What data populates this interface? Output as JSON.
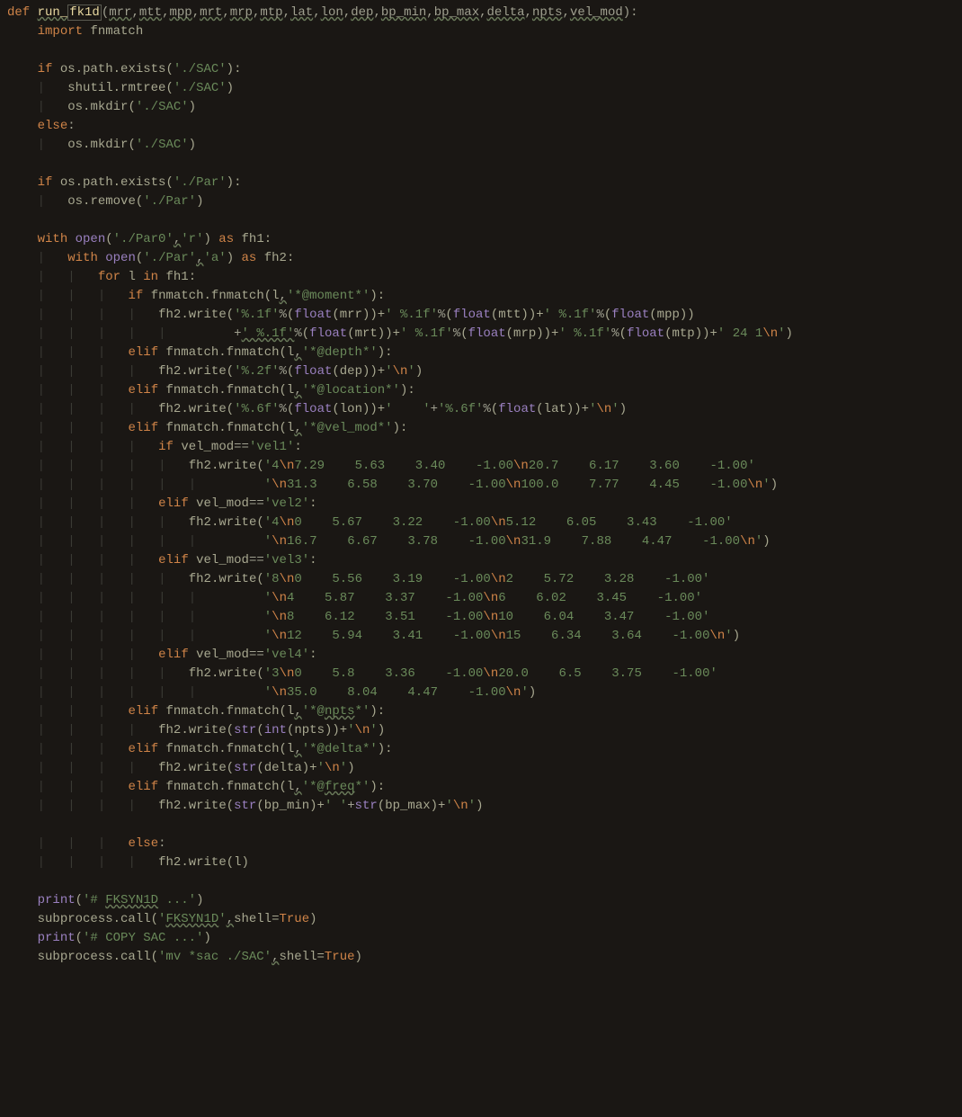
{
  "code": {
    "lines": [
      {
        "indent": 0,
        "html": "<span class='kw'>def </span><span class='fn underline-warn'>run_</span><span class='fn boxed'>fk1d</span><span class='paren'>(</span><span class='param underline-warn'>mrr</span><span class='op'>,</span><span class='param underline-warn'>mtt</span><span class='op'>,</span><span class='param underline-warn'>mpp</span><span class='op'>,</span><span class='param underline-warn'>mrt</span><span class='op'>,</span><span class='param underline-warn'>mrp</span><span class='op'>,</span><span class='param underline-warn'>mtp</span><span class='op'>,</span><span class='param underline-warn'>lat</span><span class='op'>,</span><span class='param underline-warn'>lon</span><span class='op'>,</span><span class='param underline-warn'>dep</span><span class='op'>,</span><span class='param underline-warn'>bp_min</span><span class='op'>,</span><span class='param underline-warn'>bp_max</span><span class='op'>,</span><span class='param underline-warn'>delta</span><span class='op'>,</span><span class='param underline-warn'>npts</span><span class='op'>,</span><span class='param underline-warn'>vel_mod</span><span class='paren'>)</span><span class='op'>:</span>"
      },
      {
        "indent": 1,
        "html": "<span class='kw'>import </span><span class='id'>fnmatch</span>"
      },
      {
        "indent": 0,
        "html": ""
      },
      {
        "indent": 1,
        "html": "<span class='kw'>if </span><span class='id'>os.path.exists(</span><span class='str'>'./SAC'</span><span class='id'>):</span>"
      },
      {
        "indent": 2,
        "html": "<span class='id'>shutil.rmtree(</span><span class='str'>'./SAC'</span><span class='id'>)</span>"
      },
      {
        "indent": 2,
        "html": "<span class='id'>os.mkdir(</span><span class='str'>'./SAC'</span><span class='id'>)</span>"
      },
      {
        "indent": 1,
        "html": "<span class='kw'>else</span><span class='op'>:</span>"
      },
      {
        "indent": 2,
        "html": "<span class='id'>os.mkdir(</span><span class='str'>'./SAC'</span><span class='id'>)</span>"
      },
      {
        "indent": 0,
        "html": ""
      },
      {
        "indent": 1,
        "html": "<span class='kw'>if </span><span class='id'>os.path.exists(</span><span class='str'>'./Par'</span><span class='id'>):</span>"
      },
      {
        "indent": 2,
        "html": "<span class='id'>os.remove(</span><span class='str'>'./Par'</span><span class='id'>)</span>"
      },
      {
        "indent": 0,
        "html": ""
      },
      {
        "indent": 1,
        "html": "<span class='kw'>with </span><span class='builtin'>open</span><span class='id'>(</span><span class='str'>'./Par0'</span><span class='op underline-warn'>,</span><span class='str'>'r'</span><span class='id'>) </span><span class='kw'>as </span><span class='id'>fh1:</span>"
      },
      {
        "indent": 2,
        "html": "<span class='kw'>with </span><span class='builtin'>open</span><span class='id'>(</span><span class='str'>'./Par'</span><span class='op underline-warn'>,</span><span class='str'>'a'</span><span class='id'>) </span><span class='kw'>as </span><span class='id'>fh2:</span>"
      },
      {
        "indent": 3,
        "html": "<span class='kw'>for </span><span class='id'>l </span><span class='kw'>in </span><span class='id'>fh1:</span>"
      },
      {
        "indent": 4,
        "html": "<span class='kw'>if </span><span class='id'>fnmatch.fnmatch(l</span><span class='op underline-warn'>,</span><span class='str'>'*@moment*'</span><span class='id'>):</span>"
      },
      {
        "indent": 5,
        "html": "<span class='id'>fh2.write(</span><span class='str'>'%.1f'</span><span class='op'>%</span><span class='id'>(</span><span class='builtin'>float</span><span class='id'>(mrr))+</span><span class='str'>' %.1f'</span><span class='op'>%</span><span class='id'>(</span><span class='builtin'>float</span><span class='id'>(mtt))+</span><span class='str'>' %.1f'</span><span class='op'>%</span><span class='id'>(</span><span class='builtin'>float</span><span class='id'>(mpp))</span>"
      },
      {
        "indent": 5,
        "html": "<span class='guide'>|</span>         <span class='op'>+</span><span class='str underline-warn'>' %.1f'</span><span class='op'>%</span><span class='id'>(</span><span class='builtin'>float</span><span class='id'>(mrt))+</span><span class='str'>' %.1f'</span><span class='op'>%</span><span class='id'>(</span><span class='builtin'>float</span><span class='id'>(mrp))+</span><span class='str'>' %.1f'</span><span class='op'>%</span><span class='id'>(</span><span class='builtin'>float</span><span class='id'>(mtp))+</span><span class='str'>' 24 1</span><span class='kw'>\\n</span><span class='str'>'</span><span class='id'>)</span>"
      },
      {
        "indent": 4,
        "html": "<span class='kw'>elif </span><span class='id'>fnmatch.fnmatch(l</span><span class='op underline-warn'>,</span><span class='str'>'*@depth*'</span><span class='id'>):</span>"
      },
      {
        "indent": 5,
        "html": "<span class='id'>fh2.write(</span><span class='str'>'%.2f'</span><span class='op'>%</span><span class='id'>(</span><span class='builtin'>float</span><span class='id'>(dep))+</span><span class='str'>'</span><span class='kw'>\\n</span><span class='str'>'</span><span class='id'>)</span>"
      },
      {
        "indent": 4,
        "html": "<span class='kw'>elif </span><span class='id'>fnmatch.fnmatch(l</span><span class='op underline-warn'>,</span><span class='str'>'*@location*'</span><span class='id'>):</span>"
      },
      {
        "indent": 5,
        "html": "<span class='id'>fh2.write(</span><span class='str'>'%.6f'</span><span class='op'>%</span><span class='id'>(</span><span class='builtin'>float</span><span class='id'>(lon))+</span><span class='str'>'    '</span><span class='op'>+</span><span class='str'>'%.6f'</span><span class='op'>%</span><span class='id'>(</span><span class='builtin'>float</span><span class='id'>(lat))+</span><span class='str'>'</span><span class='kw'>\\n</span><span class='str'>'</span><span class='id'>)</span>"
      },
      {
        "indent": 4,
        "html": "<span class='kw'>elif </span><span class='id'>fnmatch.fnmatch(l</span><span class='op underline-warn'>,</span><span class='str'>'*@vel_mod*'</span><span class='id'>):</span>"
      },
      {
        "indent": 5,
        "html": "<span class='kw'>if </span><span class='id'>vel_mod</span><span class='op'>==</span><span class='str'>'vel1'</span><span class='id'>:</span>"
      },
      {
        "indent": 6,
        "html": "<span class='id'>fh2.write(</span><span class='str'>'4</span><span class='kw'>\\n</span><span class='str'>7.29    5.63    3.40    -1.00</span><span class='kw'>\\n</span><span class='str'>20.7    6.17    3.60    -1.00'</span>"
      },
      {
        "indent": 6,
        "html": "<span class='guide'>|</span>         <span class='str'>'</span><span class='kw'>\\n</span><span class='str'>31.3    6.58    3.70    -1.00</span><span class='kw'>\\n</span><span class='str'>100.0    7.77    4.45    -1.00</span><span class='kw'>\\n</span><span class='str'>'</span><span class='id'>)</span>"
      },
      {
        "indent": 5,
        "html": "<span class='kw'>elif </span><span class='id'>vel_mod</span><span class='op'>==</span><span class='str'>'vel2'</span><span class='id'>:</span>"
      },
      {
        "indent": 6,
        "html": "<span class='id'>fh2.write(</span><span class='str'>'4</span><span class='kw'>\\n</span><span class='str'>0    5.67    3.22    -1.00</span><span class='kw'>\\n</span><span class='str'>5.12    6.05    3.43    -1.00'</span>"
      },
      {
        "indent": 6,
        "html": "<span class='guide'>|</span>         <span class='str'>'</span><span class='kw'>\\n</span><span class='str'>16.7    6.67    3.78    -1.00</span><span class='kw'>\\n</span><span class='str'>31.9    7.88    4.47    -1.00</span><span class='kw'>\\n</span><span class='str'>'</span><span class='id'>)</span>"
      },
      {
        "indent": 5,
        "html": "<span class='kw'>elif </span><span class='id'>vel_mod</span><span class='op'>==</span><span class='str'>'vel3'</span><span class='id'>:</span>"
      },
      {
        "indent": 6,
        "html": "<span class='id'>fh2.write(</span><span class='str'>'8</span><span class='kw'>\\n</span><span class='str'>0    5.56    3.19    -1.00</span><span class='kw'>\\n</span><span class='str'>2    5.72    3.28    -1.00'</span>"
      },
      {
        "indent": 6,
        "html": "<span class='guide'>|</span>         <span class='str'>'</span><span class='kw'>\\n</span><span class='str'>4    5.87    3.37    -1.00</span><span class='kw'>\\n</span><span class='str'>6    6.02    3.45    -1.00'</span>"
      },
      {
        "indent": 6,
        "html": "<span class='guide'>|</span>         <span class='str'>'</span><span class='kw'>\\n</span><span class='str'>8    6.12    3.51    -1.00</span><span class='kw'>\\n</span><span class='str'>10    6.04    3.47    -1.00'</span>"
      },
      {
        "indent": 6,
        "html": "<span class='guide'>|</span>         <span class='str'>'</span><span class='kw'>\\n</span><span class='str'>12    5.94    3.41    -1.00</span><span class='kw'>\\n</span><span class='str'>15    6.34    3.64    -1.00</span><span class='kw'>\\n</span><span class='str'>'</span><span class='id'>)</span>"
      },
      {
        "indent": 5,
        "html": "<span class='kw'>elif </span><span class='id'>vel_mod</span><span class='op'>==</span><span class='str'>'vel4'</span><span class='id'>:</span>"
      },
      {
        "indent": 6,
        "html": "<span class='id'>fh2.write(</span><span class='str'>'3</span><span class='kw'>\\n</span><span class='str'>0    5.8    3.36    -1.00</span><span class='kw'>\\n</span><span class='str'>20.0    6.5    3.75    -1.00'</span>"
      },
      {
        "indent": 6,
        "html": "<span class='guide'>|</span>         <span class='str'>'</span><span class='kw'>\\n</span><span class='str'>35.0    8.04    4.47    -1.00</span><span class='kw'>\\n</span><span class='str'>'</span><span class='id'>)</span>"
      },
      {
        "indent": 4,
        "html": "<span class='kw'>elif </span><span class='id'>fnmatch.fnmatch(l</span><span class='op underline-warn'>,</span><span class='str'>'*@<span class=\"underline-warn\">npts</span>*'</span><span class='id'>):</span>"
      },
      {
        "indent": 5,
        "html": "<span class='id'>fh2.write(</span><span class='builtin'>str</span><span class='id'>(</span><span class='builtin'>int</span><span class='id'>(npts))+</span><span class='str'>'</span><span class='kw'>\\n</span><span class='str'>'</span><span class='id'>)</span>"
      },
      {
        "indent": 4,
        "html": "<span class='kw'>elif </span><span class='id'>fnmatch.fnmatch(l</span><span class='op underline-warn'>,</span><span class='str'>'*@delta*'</span><span class='id'>):</span>"
      },
      {
        "indent": 5,
        "html": "<span class='id'>fh2.write(</span><span class='builtin'>str</span><span class='id'>(delta)+</span><span class='str'>'</span><span class='kw'>\\n</span><span class='str'>'</span><span class='id'>)</span>"
      },
      {
        "indent": 4,
        "html": "<span class='kw'>elif </span><span class='id'>fnmatch.fnmatch(l</span><span class='op underline-warn'>,</span><span class='str'>'*@<span class=\"underline-warn\">freq</span>*'</span><span class='id'>):</span>"
      },
      {
        "indent": 5,
        "html": "<span class='id'>fh2.write(</span><span class='builtin'>str</span><span class='id'>(bp_min)+</span><span class='str'>' '</span><span class='op'>+</span><span class='builtin'>str</span><span class='id'>(bp_max)+</span><span class='str'>'</span><span class='kw'>\\n</span><span class='str'>'</span><span class='id'>)</span>"
      },
      {
        "indent": 0,
        "html": ""
      },
      {
        "indent": 4,
        "html": "<span class='kw'>else</span><span class='op'>:</span>"
      },
      {
        "indent": 5,
        "html": "<span class='id'>fh2.write(l)</span>"
      },
      {
        "indent": 0,
        "html": ""
      },
      {
        "indent": 1,
        "html": "<span class='builtin'>print</span><span class='id'>(</span><span class='str'>'# <span class=\"underline-warn\">FKSYN1D</span> ...'</span><span class='id'>)</span>"
      },
      {
        "indent": 1,
        "html": "<span class='id'>subprocess.call(</span><span class='str'>'<span class=\"underline-warn\">FKSYN1D</span>'</span><span class='op underline-warn'>,</span><span class='id'>shell=</span><span class='kw'>True</span><span class='id'>)</span>"
      },
      {
        "indent": 1,
        "html": "<span class='builtin'>print</span><span class='id'>(</span><span class='str'>'# COPY SAC ...'</span><span class='id'>)</span>"
      },
      {
        "indent": 1,
        "html": "<span class='id'>subprocess.call(</span><span class='str'>'mv *sac ./SAC'</span><span class='op underline-warn'>,</span><span class='id'>shell=</span><span class='kw'>True</span><span class='id'>)</span>"
      }
    ]
  },
  "indent_unit": "    ",
  "guide_char": "|"
}
